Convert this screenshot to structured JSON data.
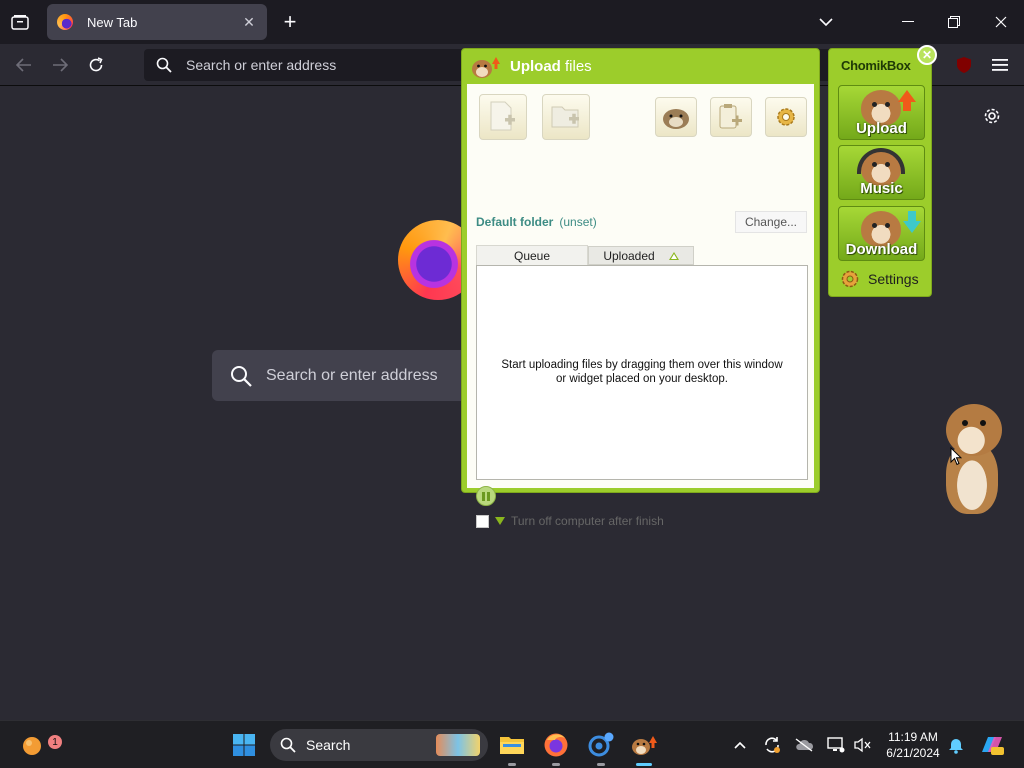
{
  "browser": {
    "tab_title": "New Tab",
    "urlbar_placeholder": "Search or enter address",
    "page_search_placeholder": "Search or enter address"
  },
  "upload_window": {
    "title_bold": "Upload",
    "title_rest": " files",
    "default_folder_label": "Default folder",
    "default_folder_value": "(unset)",
    "change_button": "Change...",
    "tabs": {
      "queue": "Queue",
      "uploaded": "Uploaded"
    },
    "empty_message": "Start uploading files by dragging them over this window or widget placed on your desktop.",
    "turn_off_label": "Turn off computer after finish"
  },
  "chomikbox_widget": {
    "title": "ChomikBox",
    "buttons": {
      "upload": "Upload",
      "music": "Music",
      "download": "Download"
    },
    "settings": "Settings"
  },
  "taskbar": {
    "search_label": "Search",
    "widgets_badge": "1",
    "time": "11:19 AM",
    "date": "6/21/2024"
  },
  "colors": {
    "chomik_green": "#9ccd2b",
    "browser_bg": "#2b2a33",
    "taskbar_bg": "#1f1f23",
    "accent_blue": "#60cdff"
  }
}
